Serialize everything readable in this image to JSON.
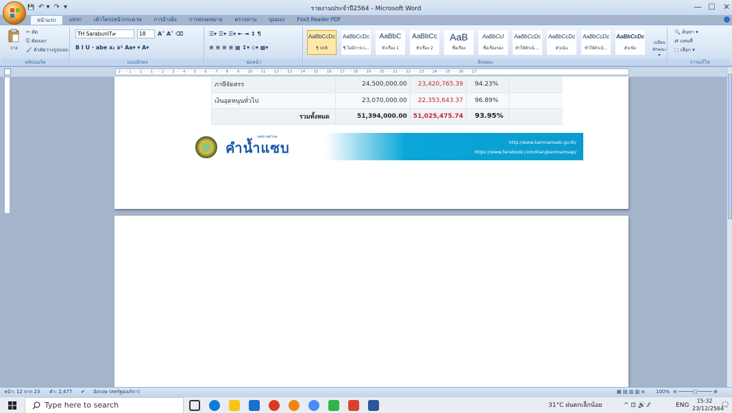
{
  "window": {
    "title": "รายงานประจำปี2564 - Microsoft Word",
    "minimize": "—",
    "restore": "☐",
    "close": "✕"
  },
  "qat": {
    "save": "💾",
    "undo": "↶ ▾",
    "redo": "↷",
    "more": "▾"
  },
  "tabs": [
    "หน้าแรก",
    "แทรก",
    "เค้าโครงหน้ากระดาษ",
    "การอ้างอิง",
    "การส่งจดหมาย",
    "ตรวจทาน",
    "มุมมอง",
    "Foxit Reader PDF"
  ],
  "clipboard": {
    "paste": "วาง",
    "cut": "ตัด",
    "copy": "คัดลอก",
    "format_painter": "ตัวคัดวางรูปแบบ",
    "label": "คลิปบอร์ด"
  },
  "font": {
    "name": "TH SarabunIT๙",
    "size": "18",
    "label": "แบบอักษร",
    "row2": "B  I  U  ·  abe  x₂  x²  Aa▾  ▾  A▾"
  },
  "paragraph": {
    "row1": "☰▾ ☰▾ ☰▾ ⇤ ⇥ ↕ ¶",
    "row2": "≡ ≡ ≡ ≡ ▦ ↕▾ ◇▾ ▦▾",
    "label": "ย่อหน้า"
  },
  "styles": {
    "label": "ลักษณะ",
    "items": [
      {
        "sample": "AaBbCcDc",
        "name": "¶ ปกติ"
      },
      {
        "sample": "AaBbCcDc",
        "name": "¶ ไม่มีการเว..."
      },
      {
        "sample": "AaBbC",
        "name": "หัวเรื่อง 1"
      },
      {
        "sample": "AaBbCc",
        "name": "หัวเรื่อง 2"
      },
      {
        "sample": "AaB",
        "name": "ชื่อเรื่อง"
      },
      {
        "sample": "AaBbCcI",
        "name": "ชื่อเรื่องรอง"
      },
      {
        "sample": "AaBbCcDc",
        "name": "ทำให้ตัวเน้...."
      },
      {
        "sample": "AaBbCcDc",
        "name": "ตัวเน้น"
      },
      {
        "sample": "AaBbCcDc",
        "name": "ทำให้ตัวเน้..."
      },
      {
        "sample": "AaBbCcDc",
        "name": "ตัวเข้ม"
      }
    ],
    "change": "เปลี่ยน ลักษณะ ▾"
  },
  "editing": {
    "find": "ค้นหา ▾",
    "replace": "แทนที่",
    "select": "เลือก ▾",
    "label": "การแก้ไข"
  },
  "ruler": "· 2 · · · 1 · · · 1 · · · 1 · · · 2 · · · 3 · · · 4 · · · 5 · · · 6 · · · 7 · · · 8 · · · 9 · · · 10 · · · 11 · · · 12 · · · 13 · · · 14 · · · 15 · · · 16 · · · 17 · · · 18 · · · 19 · · · 20 · · · 21 · · · 22 · · · 23 · · · 24 · · · 25 · · · 26 · · · 27",
  "document_table": [
    {
      "item": "ภาษีจัดสรร",
      "budget": "24,500,000.00",
      "actual": "23,420,765.39",
      "percent": "94.23%"
    },
    {
      "item": "เงินอุดหนุนทั่วไป",
      "budget": "23,070,000.00",
      "actual": "22,353,643.37",
      "percent": "96.89%"
    },
    {
      "item": "รวมทั้งหมด",
      "budget": "51,394,000.00",
      "actual": "51,025,475.74",
      "percent": "93.95%"
    }
  ],
  "document_footer": {
    "brand": "คำน้ำแซบ",
    "brand_sub": "เทศบาลตำบล",
    "website": "http://www.kamnamsab.go.th/",
    "facebook": "https://www.facebook.com/klangkamnamsap/"
  },
  "status": {
    "page": "หน้า: 12 จาก 23",
    "words": "คำ: 2,477",
    "language": "อังกฤษ (สหรัฐอเมริกา)",
    "zoom": "100%",
    "zoom_ctrl": "⊖ ─────▢───── ⊕"
  },
  "taskbar": {
    "search_placeholder": "Type here to search",
    "weather": "31°C  ฝนตกเล็กน้อย",
    "tray_icons": "^  ⊡  🔊  ⁄⁄",
    "lang": "ENG",
    "time": "15:32",
    "date": "23/12/2564",
    "notif_count": "2"
  }
}
